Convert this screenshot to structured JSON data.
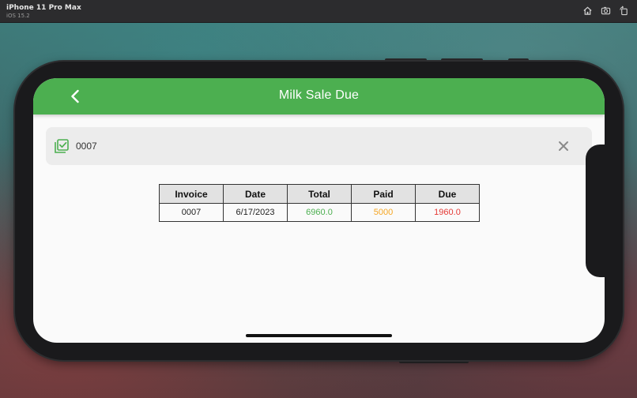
{
  "simulator": {
    "device_name": "iPhone 11 Pro Max",
    "os_version": "iOS 15.2",
    "toolbar_icons": [
      "home-icon",
      "screenshot-icon",
      "rotate-icon"
    ]
  },
  "header": {
    "title": "Milk Sale Due",
    "back_icon": "chevron-left-icon",
    "color": "#4caf50"
  },
  "search": {
    "value": "0007",
    "icon": "checklist-icon",
    "clear_icon": "close-icon"
  },
  "table": {
    "columns": [
      "Invoice",
      "Date",
      "Total",
      "Paid",
      "Due"
    ],
    "rows": [
      {
        "invoice": "0007",
        "date": "6/17/2023",
        "total": "6960.0",
        "paid": "5000",
        "due": "1960.0"
      }
    ],
    "colors": {
      "total": "#4caf50",
      "paid": "#f5a623",
      "due": "#e53935"
    }
  }
}
